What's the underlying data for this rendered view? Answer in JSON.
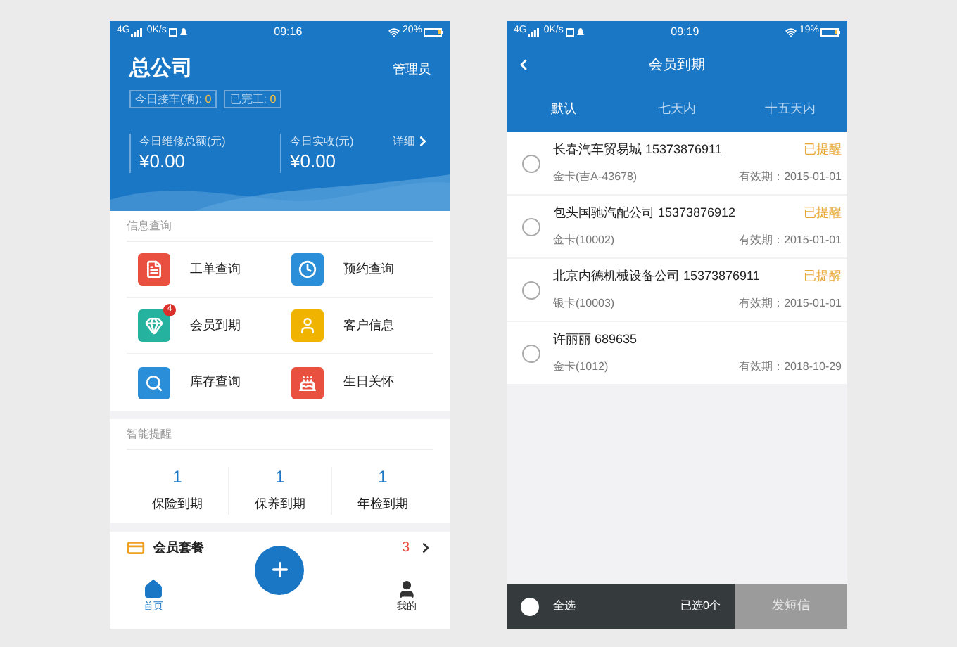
{
  "home_screen": {
    "status_bar": {
      "network": "4G",
      "speed": "0K/s",
      "time": "09:16",
      "battery": "20%"
    },
    "header": {
      "title": "总公司",
      "role": "管理员",
      "stats": [
        {
          "label": "今日接车(辆):",
          "value": "0"
        },
        {
          "label": "已完工:",
          "value": "0"
        }
      ],
      "totals": [
        {
          "label": "今日维修总额(元)",
          "amount": "¥0.00"
        },
        {
          "label": "今日实收(元)",
          "amount": "¥0.00"
        }
      ],
      "detail_link": "详细"
    },
    "info_section": {
      "title": "信息查询",
      "items": [
        {
          "label": "工单查询",
          "kind": "document"
        },
        {
          "label": "预约查询",
          "kind": "clock"
        },
        {
          "label": "会员到期",
          "kind": "vip",
          "badge": "4"
        },
        {
          "label": "客户信息",
          "kind": "person"
        },
        {
          "label": "库存查询",
          "kind": "search"
        },
        {
          "label": "生日关怀",
          "kind": "cake"
        }
      ]
    },
    "reminder_section": {
      "title": "智能提醒",
      "items": [
        {
          "count": "1",
          "label": "保险到期"
        },
        {
          "count": "1",
          "label": "保养到期"
        },
        {
          "count": "1",
          "label": "年检到期"
        }
      ]
    },
    "package_row": {
      "title": "会员套餐",
      "count": "3"
    },
    "tab_bar": {
      "items": [
        {
          "label": "首页",
          "kind": "home",
          "selected": true
        },
        {
          "label": "我的",
          "kind": "user",
          "selected": false
        }
      ]
    }
  },
  "expiry_screen": {
    "status_bar": {
      "network": "4G",
      "speed": "0K/s",
      "time": "09:19",
      "battery": "19%"
    },
    "title": "会员到期",
    "tabs": [
      {
        "label": "默认",
        "selected": true
      },
      {
        "label": "七天内",
        "selected": false
      },
      {
        "label": "十五天内",
        "selected": false
      }
    ],
    "rows": [
      {
        "name": "长春汽车贸易城 15373876911",
        "card": "金卡(吉A-43678)",
        "expiry_label": "有效期：",
        "expiry": "2015-01-01",
        "status": "已提醒",
        "checked": false
      },
      {
        "name": "包头国驰汽配公司 15373876912",
        "card": "金卡(10002)",
        "expiry_label": "有效期：",
        "expiry": "2015-01-01",
        "status": "已提醒",
        "checked": false
      },
      {
        "name": "北京内德机械设备公司 15373876911",
        "card": "银卡(10003)",
        "expiry_label": "有效期：",
        "expiry": "2015-01-01",
        "status": "已提醒",
        "checked": false
      },
      {
        "name": "许丽丽 689635",
        "card": "金卡(1012)",
        "expiry_label": "有效期：",
        "expiry": "2018-10-29",
        "checked": false
      }
    ],
    "footer": {
      "select_all": "全选",
      "select_all_checked": false,
      "selected_count": "已选0个",
      "send_button": "发短信",
      "send_disabled": true
    }
  }
}
